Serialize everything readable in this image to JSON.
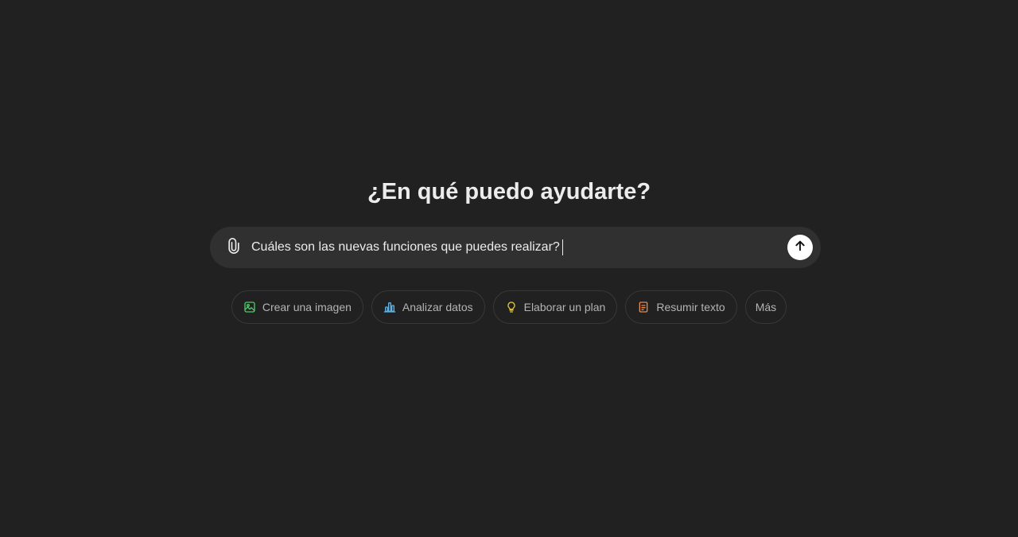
{
  "main": {
    "heading": "¿En qué puedo ayudarte?"
  },
  "composer": {
    "input_value": "Cuáles son las nuevas funciones que puedes realizar?",
    "attach_icon": "paperclip-icon",
    "send_icon": "arrow-up-icon"
  },
  "suggestions": {
    "items": [
      {
        "label": "Crear una imagen",
        "icon": "image-icon",
        "color": "#4ec96b"
      },
      {
        "label": "Analizar datos",
        "icon": "bar-chart-icon",
        "color": "#5fb3e6"
      },
      {
        "label": "Elaborar un plan",
        "icon": "lightbulb-icon",
        "color": "#e2c541"
      },
      {
        "label": "Resumir texto",
        "icon": "document-icon",
        "color": "#e88a4a"
      }
    ],
    "more_label": "Más"
  },
  "colors": {
    "background": "#212121",
    "composer_bg": "#303030",
    "text_primary": "#ececec",
    "text_secondary": "#b4b4b4",
    "send_button_bg": "#ffffff"
  }
}
